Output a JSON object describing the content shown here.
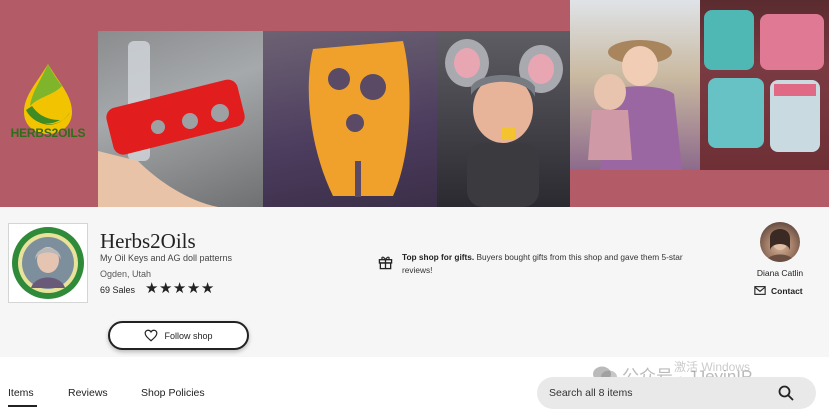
{
  "banner": {
    "logo_text": "HERBS2OILS",
    "colors": {
      "background": "#b35c67",
      "logo_green": "#2f6d1b",
      "logo_yellow": "#f2c300"
    }
  },
  "shop": {
    "name": "Herbs2Oils",
    "tagline": "My Oil Keys and AG doll patterns",
    "location": "Ogden, Utah",
    "sales": "69 Sales",
    "rating_stars": 5,
    "follow_label": "Follow shop"
  },
  "top_shop": {
    "title": "Top shop for gifts.",
    "text": "Buyers bought gifts from this shop and gave them 5-star reviews!"
  },
  "owner": {
    "name": "Diana Catlin",
    "contact_label": "Contact"
  },
  "tabs": {
    "items": "Items",
    "reviews": "Reviews",
    "policies": "Shop Policies"
  },
  "search": {
    "placeholder": "Search all 8 items"
  },
  "watermark": {
    "text": "公众号 · JJeyinIP",
    "activate": "激活 Windows"
  }
}
